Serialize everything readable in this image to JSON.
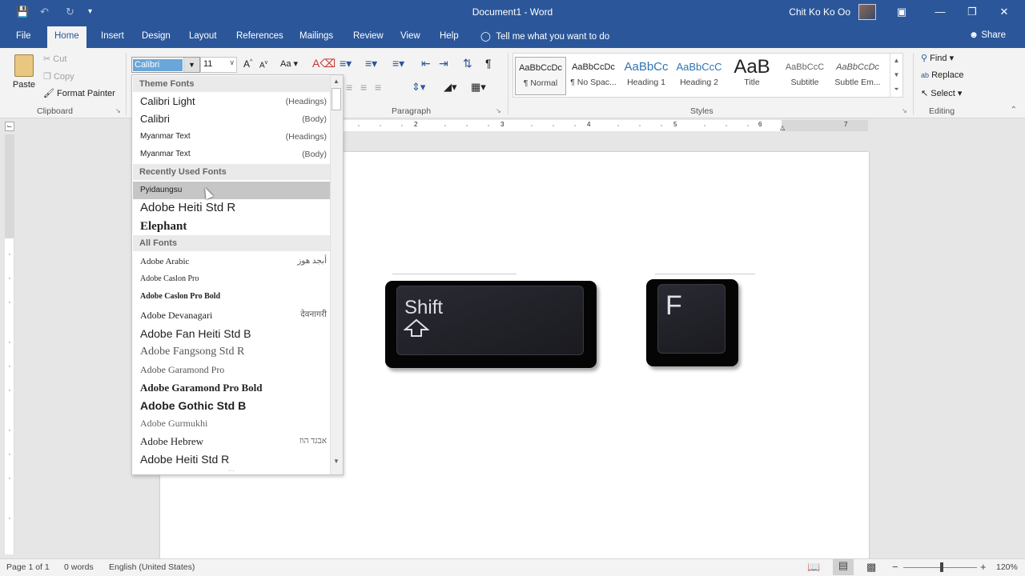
{
  "title_bar": {
    "document_title": "Document1 - Word",
    "user_name": "Chit Ko Ko Oo",
    "save_icon": "save-icon",
    "undo_icon": "undo-icon",
    "redo_icon": "redo-icon",
    "customize_icon": "customize-qat-icon"
  },
  "tabs": [
    "File",
    "Home",
    "Insert",
    "Design",
    "Layout",
    "References",
    "Mailings",
    "Review",
    "View",
    "Help"
  ],
  "tell_me": "Tell me what you want to do",
  "share": "Share",
  "clipboard": {
    "paste": "Paste",
    "cut": "Cut",
    "copy": "Copy",
    "format_painter": "Format Painter",
    "group_label": "Clipboard"
  },
  "font": {
    "current_font": "Calibri",
    "current_size": "11",
    "grow": "A",
    "shrink": "A",
    "change_case": "Aa"
  },
  "paragraph": {
    "group_label": "Paragraph"
  },
  "styles": {
    "group_label": "Styles",
    "items": [
      {
        "preview": "AaBbCcDc",
        "name": "¶ Normal"
      },
      {
        "preview": "AaBbCcDc",
        "name": "¶ No Spac..."
      },
      {
        "preview": "AaBbCc",
        "name": "Heading 1"
      },
      {
        "preview": "AaBbCcC",
        "name": "Heading 2"
      },
      {
        "preview": "AaB",
        "name": "Title"
      },
      {
        "preview": "AaBbCcC",
        "name": "Subtitle"
      },
      {
        "preview": "AaBbCcDc",
        "name": "Subtle Em..."
      }
    ]
  },
  "editing": {
    "find": "Find",
    "replace": "Replace",
    "select": "Select",
    "group_label": "Editing"
  },
  "font_dropdown": {
    "theme_header": "Theme Fonts",
    "theme_fonts": [
      {
        "name": "Calibri Light",
        "hint": "(Headings)"
      },
      {
        "name": "Calibri",
        "hint": "(Body)"
      },
      {
        "name": "Myanmar Text",
        "hint": "(Headings)"
      },
      {
        "name": "Myanmar Text",
        "hint": "(Body)"
      }
    ],
    "recent_header": "Recently Used Fonts",
    "recent_fonts": [
      "Pyidaungsu",
      "Adobe Heiti Std R",
      "Elephant"
    ],
    "all_header": "All Fonts",
    "all_fonts": [
      {
        "name": "Adobe Arabic",
        "hint": "أبجد هوز"
      },
      {
        "name": "Adobe Caslon Pro",
        "hint": ""
      },
      {
        "name": "Adobe Caslon Pro Bold",
        "hint": ""
      },
      {
        "name": "Adobe Devanagari",
        "hint": "देवनागरी"
      },
      {
        "name": "Adobe Fan Heiti Std B",
        "hint": ""
      },
      {
        "name": "Adobe Fangsong Std R",
        "hint": ""
      },
      {
        "name": "Adobe Garamond Pro",
        "hint": ""
      },
      {
        "name": "Adobe Garamond Pro Bold",
        "hint": ""
      },
      {
        "name": "Adobe Gothic Std B",
        "hint": ""
      },
      {
        "name": "Adobe Gurmukhi",
        "hint": ""
      },
      {
        "name": "Adobe Hebrew",
        "hint": "אבגד הוז"
      },
      {
        "name": "Adobe Heiti Std R",
        "hint": ""
      }
    ]
  },
  "ruler_numbers": [
    "2",
    "3",
    "4",
    "5",
    "6",
    "7"
  ],
  "keys": {
    "shift": "Shift",
    "f": "F"
  },
  "status": {
    "page": "Page 1 of 1",
    "words": "0 words",
    "language": "English (United States)",
    "zoom": "120%"
  }
}
